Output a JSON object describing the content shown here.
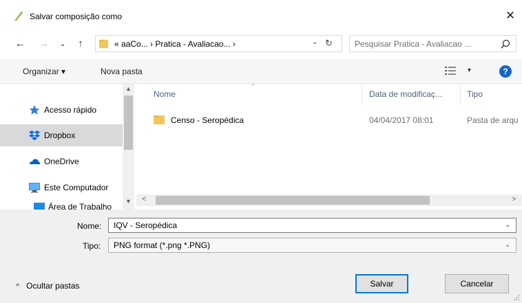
{
  "window": {
    "title": "Salvar composição como",
    "close_glyph": "✕"
  },
  "nav": {
    "back_glyph": "←",
    "forward_glyph": "→",
    "recent_glyph": "⌄",
    "up_glyph": "↑",
    "address_prefix": "«",
    "address_path": "aaCo...  ›  Pratica - Avaliacao...  ›",
    "address_chevron": "⌄",
    "refresh_glyph": "↻",
    "search_placeholder": "Pesquisar Pratica - Avaliacao ..."
  },
  "toolbar": {
    "organize_label": "Organizar ▾",
    "new_folder_label": "Nova pasta",
    "view_chevron": "▾",
    "help_label": "?"
  },
  "sidebar": {
    "scroll_up": "▲",
    "scroll_down": "▼",
    "items": [
      {
        "label": "Acesso rápido",
        "icon": "star-icon"
      },
      {
        "label": "Dropbox",
        "icon": "dropbox-icon",
        "selected": true
      },
      {
        "label": "OneDrive",
        "icon": "onedrive-icon"
      },
      {
        "label": "Este Computador",
        "icon": "computer-icon"
      },
      {
        "label": "Área de Trabalho",
        "icon": "desktop-icon"
      }
    ]
  },
  "file_list": {
    "columns": [
      "Nome",
      "Data de modificaç...",
      "Tipo"
    ],
    "sort_glyph": "^",
    "rows": [
      {
        "name": "Censo - Seropédica",
        "modified": "04/04/2017 08:01",
        "type": "Pasta de arqu"
      }
    ],
    "hscroll_left": "<",
    "hscroll_right": ">"
  },
  "form": {
    "name_label": "Nome:",
    "name_value": "IQV - Seropédica",
    "type_label": "Tipo:",
    "type_value": "PNG format (*.png *.PNG)",
    "chevron": "⌄"
  },
  "footer": {
    "hide_folders_glyph": "^",
    "hide_folders_label": "Ocultar pastas",
    "save_label": "Salvar",
    "cancel_label": "Cancelar"
  },
  "colors": {
    "folder": "#f0c75e",
    "selected_row": "#d9d9d9",
    "accent": "#0078d7",
    "help": "#1565c0",
    "dropbox": "#0061fe",
    "onedrive": "#0364b8",
    "star": "#2f7ed8"
  }
}
